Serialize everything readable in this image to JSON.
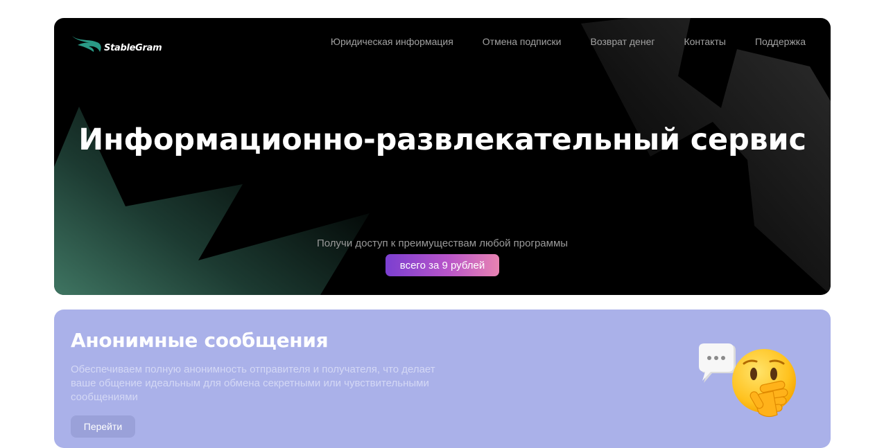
{
  "brand": {
    "name": "StableGram",
    "logo_icon": "wave-logo-icon"
  },
  "nav": {
    "items": [
      {
        "label": "Юридическая информация"
      },
      {
        "label": "Отмена подписки"
      },
      {
        "label": "Возврат денег"
      },
      {
        "label": "Контакты"
      },
      {
        "label": "Поддержка"
      }
    ]
  },
  "hero": {
    "title": "Информационно-развлекательный сервис",
    "subtitle": "Получи доступ к преимуществам любой программы",
    "price_badge": "всего за 9 рублей"
  },
  "feature": {
    "title": "Анонимные сообщения",
    "description": "Обеспечиваем полную анонимность отправителя и получателя, что делает ваше общение идеальным для обмена секретными или чувствительными сообщениями",
    "button_label": "Перейти",
    "icons": [
      "speech-bubble-icon",
      "hand-over-mouth-emoji-icon"
    ]
  },
  "colors": {
    "hero_bg": "#000000",
    "feature_bg": "#aab1e9",
    "badge_gradient_start": "#7b3fd0",
    "badge_gradient_end": "#e883b2",
    "logo_accent": "#2a9a86"
  }
}
